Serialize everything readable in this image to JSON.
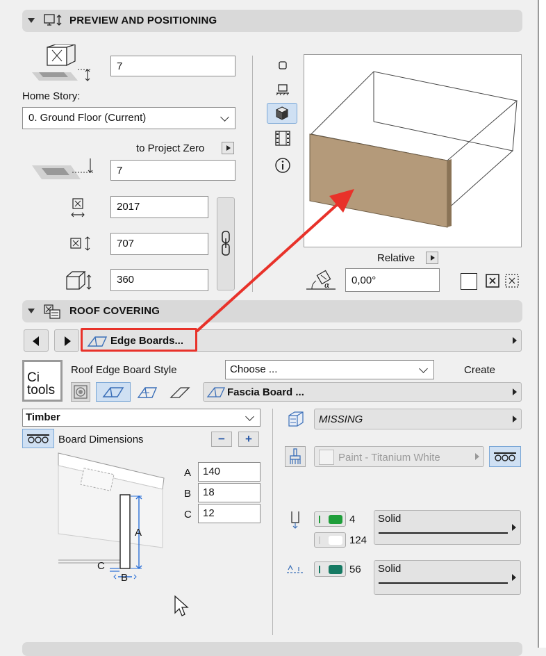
{
  "preview": {
    "title": "PREVIEW AND POSITIONING",
    "elevation_value": "7",
    "home_story_label": "Home Story:",
    "home_story_value": "0. Ground Floor (Current)",
    "to_project_zero_label": "to Project Zero",
    "project_zero_value": "7",
    "length_value": "2017",
    "height_value": "707",
    "depth_value": "360",
    "relative_label": "Relative",
    "angle_value": "0,00°"
  },
  "roof": {
    "title": "ROOF COVERING",
    "edge_boards_label": "Edge Boards...",
    "style_label": "Roof Edge Board Style",
    "choose_value": "Choose ...",
    "create_label": "Create",
    "fascia_label": "Fascia Board ...",
    "logo_line1": "Ci",
    "logo_line2": "tools",
    "material_value": "Timber",
    "board_dimensions_label": "Board Dimensions",
    "minus": "−",
    "plus": "+",
    "dims": [
      {
        "letter": "A",
        "value": "140"
      },
      {
        "letter": "B",
        "value": "18"
      },
      {
        "letter": "C",
        "value": "12"
      }
    ],
    "diagram_labels": {
      "a": "A",
      "b": "B",
      "c": "C"
    },
    "surface_value": "MISSING",
    "paint_value": "Paint - Titanium White",
    "pen1_value": "4",
    "pen2_value": "124",
    "pen3_value": "56",
    "line1_value": "Solid",
    "line2_value": "Solid"
  },
  "colors": {
    "accent_red": "#e8322a",
    "board_fill": "#b49a7a",
    "pen_green": "#1f9e3a",
    "pen_teal": "#167a63",
    "selected_blue": "#cfe0f3"
  }
}
